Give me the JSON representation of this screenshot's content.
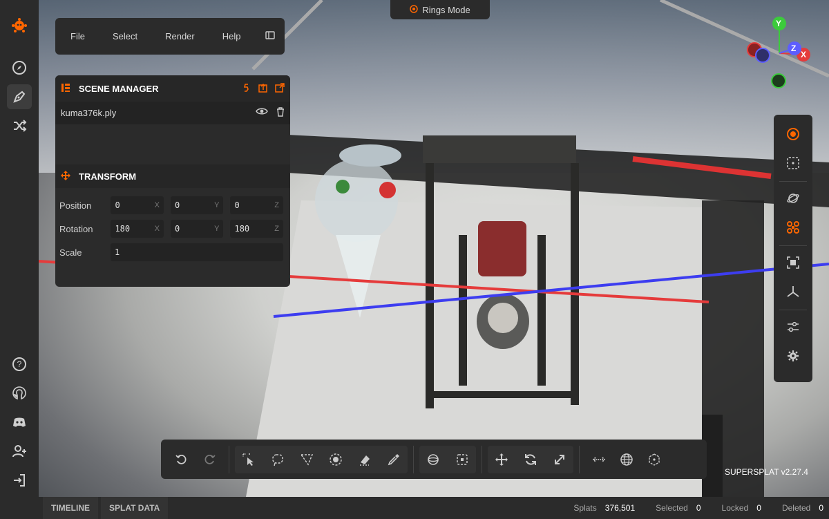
{
  "menu": {
    "items": [
      "File",
      "Select",
      "Render",
      "Help"
    ]
  },
  "mode": {
    "label": "Rings Mode"
  },
  "scene_manager": {
    "title": "SCENE MANAGER",
    "items": [
      {
        "name": "kuma376k.ply"
      }
    ]
  },
  "transform": {
    "title": "TRANSFORM",
    "rows": [
      {
        "label": "Position",
        "values": [
          "0",
          "0",
          "0"
        ],
        "axes": [
          "X",
          "Y",
          "Z"
        ]
      },
      {
        "label": "Rotation",
        "values": [
          "180",
          "0",
          "180"
        ],
        "axes": [
          "X",
          "Y",
          "Z"
        ]
      },
      {
        "label": "Scale",
        "value": "1"
      }
    ]
  },
  "bottom_tabs": [
    "TIMELINE",
    "SPLAT DATA"
  ],
  "stats": [
    {
      "label": "Splats",
      "value": "376,501"
    },
    {
      "label": "Selected",
      "value": "0"
    },
    {
      "label": "Locked",
      "value": "0"
    },
    {
      "label": "Deleted",
      "value": "0"
    }
  ],
  "version": "SUPERSPLAT v2.27.4",
  "gizmo": {
    "y": "Y",
    "z": "Z",
    "x": "X"
  },
  "colors": {
    "accent": "#ff6600",
    "panel": "#2b2b2b",
    "x_axis": "#e53b3b",
    "y_axis": "#3ccb3c",
    "z_axis": "#5d5dff"
  }
}
